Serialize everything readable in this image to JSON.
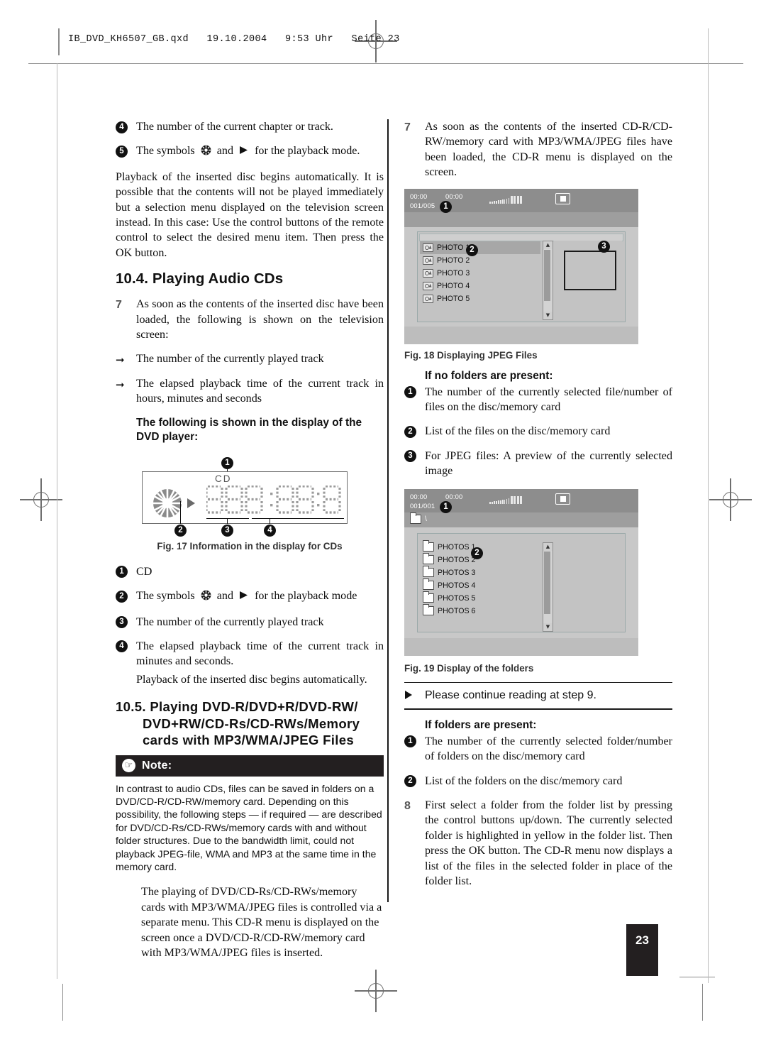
{
  "header": {
    "file_info": "IB_DVD_KH6507_GB.qxd   19.10.2004   9:53 Uhr   Seite 23"
  },
  "page_number": "23",
  "left_column": {
    "item4_label": "4",
    "item4_text": "The number of the current chapter or track.",
    "item5_label": "5",
    "item5_text_a": "The symbols",
    "item5_text_b": "and",
    "item5_text_c": "for the playback mode.",
    "paragraph_playback": "Playback of the inserted disc begins automatically. It is possible that the contents will not be played immediately but a selection menu displayed on the television screen instead. In this case: Use the control buttons of the remote control to select the desired menu item. Then press the OK button.",
    "section_10_4": "10.4. Playing Audio CDs",
    "step7_num": "7",
    "step7_text": "As soon as the contents of the inserted disc have been loaded, the following is shown on the television screen:",
    "arrow1_text": "The number of the currently played track",
    "arrow2_text": "The elapsed playback time of the current track in hours, minutes and seconds",
    "display_subhead": "The following is shown in the display of the DVD player:",
    "fig17": {
      "cd_label": "CD",
      "callout1": "1",
      "callout2": "2",
      "callout3": "3",
      "callout4": "4",
      "caption": "Fig. 17 Information in the display for CDs"
    },
    "legend": [
      {
        "num": "1",
        "text": "CD"
      },
      {
        "num": "3",
        "text": "The number of the currently played track"
      }
    ],
    "legend2_label": "2",
    "legend2_a": "The symbols",
    "legend2_b": "and",
    "legend2_c": "for the playback mode",
    "legend4_label": "4",
    "legend4_text": "The elapsed playback time of the current track in minutes and seconds.",
    "legend4_extra": "Playback of the inserted disc begins automatically.",
    "section_10_5_line1": "10.5. Playing DVD-R/DVD+R/DVD-RW/",
    "section_10_5_line2": "DVD+RW/CD-Rs/CD-RWs/Memory",
    "section_10_5_line3": "cards with MP3/WMA/JPEG Files",
    "note_label": "Note:",
    "note_icon": "pointing-hand-icon",
    "note_body": "In contrast to audio CDs, files can be saved in folders on a DVD/CD-R/CD-RW/memory card. Depending on this possibility, the following steps — if required — are described for DVD/CD-Rs/CD-RWs/memory cards with and without folder structures. Due to the bandwidth limit, could not playback JPEG-file, WMA and MP3 at the same time in the memory card.",
    "indent_paragraph": "The playing of DVD/CD-Rs/CD-RWs/memory cards with MP3/WMA/JPEG files is controlled via a separate menu. This CD-R menu is displayed on the screen once a DVD/CD-R/CD-RW/memory card with MP3/WMA/JPEG files is inserted."
  },
  "right_column": {
    "step7_num": "7",
    "step7_text": "As soon as the contents of the inserted CD-R/CD-RW/memory card with MP3/WMA/JPEG files have been loaded, the CD-R menu is displayed on the screen.",
    "fig18": {
      "time_elapsed": "00:00",
      "time_total": "00:00",
      "counter": "001/005",
      "callout1": "1",
      "callout2": "2",
      "callout3": "3",
      "files": [
        "PHOTO 1",
        "PHOTO 2",
        "PHOTO 3",
        "PHOTO 4",
        "PHOTO 5"
      ],
      "selected_index": 0,
      "caption": "Fig. 18 Displaying JPEG Files",
      "stop_icon": "stop-icon",
      "file_icon": "image-file-icon"
    },
    "no_folders_head": "If no folders are present:",
    "no_folders": [
      {
        "num": "1",
        "text": "The number of the currently selected file/number of files on the disc/memory card"
      },
      {
        "num": "2",
        "text": "List of the files on the disc/memory card"
      },
      {
        "num": "3",
        "text": "For JPEG files: A preview of the currently selected image"
      }
    ],
    "fig19": {
      "time_elapsed": "00:00",
      "time_total": "00:00",
      "counter": "001/001",
      "path": "\\",
      "callout1": "1",
      "callout2": "2",
      "folders": [
        "PHOTOS 1",
        "PHOTOS 2",
        "PHOTOS 3",
        "PHOTOS 4",
        "PHOTOS 5",
        "PHOTOS 6"
      ],
      "caption": "Fig. 19 Display of the folders",
      "folder_icon": "folder-icon",
      "stop_icon": "stop-icon"
    },
    "continue_text": "Please continue reading at step 9.",
    "folders_head": "If folders are present:",
    "folders_present": [
      {
        "num": "1",
        "text": "The number of the currently selected folder/number of folders on the disc/memory card"
      },
      {
        "num": "2",
        "text": "List of the folders on the disc/memory card"
      }
    ],
    "step8_num": "8",
    "step8_text": "First select a folder from the folder list by pressing the control buttons up/down. The currently selected folder is highlighted in yellow in the folder list. Then press the OK button. The CD-R menu now displays a list of the files in the selected folder in place of the folder list."
  }
}
